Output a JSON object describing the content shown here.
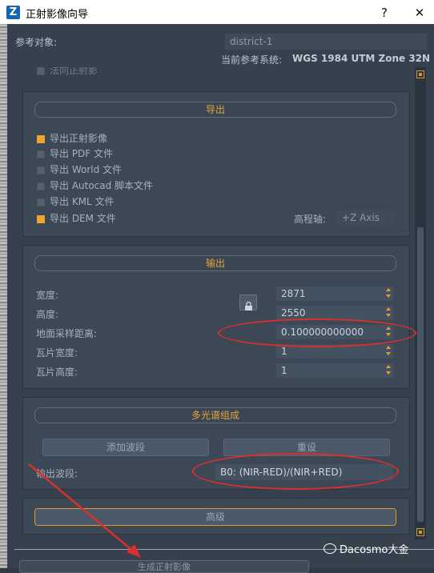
{
  "window": {
    "icon_letter": "Z",
    "title": "正射影像向导",
    "help_glyph": "?",
    "close_glyph": "✕"
  },
  "reference": {
    "label": "参考对象:",
    "value": "district-1",
    "crs_label": "当前参考系统:",
    "crs_value": "WGS 1984 UTM Zone 32N"
  },
  "partial_row": {
    "label": "法向正射影"
  },
  "export": {
    "header": "导出",
    "options": [
      {
        "label": "导出正射影像",
        "checked": true
      },
      {
        "label": "导出 PDF 文件",
        "checked": false
      },
      {
        "label": "导出 World 文件",
        "checked": false
      },
      {
        "label": "导出 Autocad 脚本文件",
        "checked": false
      },
      {
        "label": "导出 KML 文件",
        "checked": false
      },
      {
        "label": "导出 DEM 文件",
        "checked": true
      }
    ],
    "elevation_axis_label": "高程轴:",
    "elevation_axis_value": "+Z Axis"
  },
  "output": {
    "header": "输出",
    "width_label": "宽度:",
    "width_value": "2871",
    "height_label": "高度:",
    "height_value": "2550",
    "gsd_label": "地面采样距离:",
    "gsd_value": "0.100000000000",
    "tile_width_label": "瓦片宽度:",
    "tile_width_value": "1",
    "tile_height_label": "瓦片高度:",
    "tile_height_value": "1"
  },
  "multispectral": {
    "header": "多光谱组成",
    "add_band_button": "添加波段",
    "reset_button": "重设",
    "output_band_label": "输出波段:",
    "output_band_value": "B0: (NIR-RED)/(NIR+RED)"
  },
  "advanced_button": "高级",
  "bottom_button": "生成正射影像",
  "watermark": "Dacosmo大金",
  "colors": {
    "accent": "#f0a22e",
    "annotation": "#d9302c",
    "background": "#36414d"
  }
}
